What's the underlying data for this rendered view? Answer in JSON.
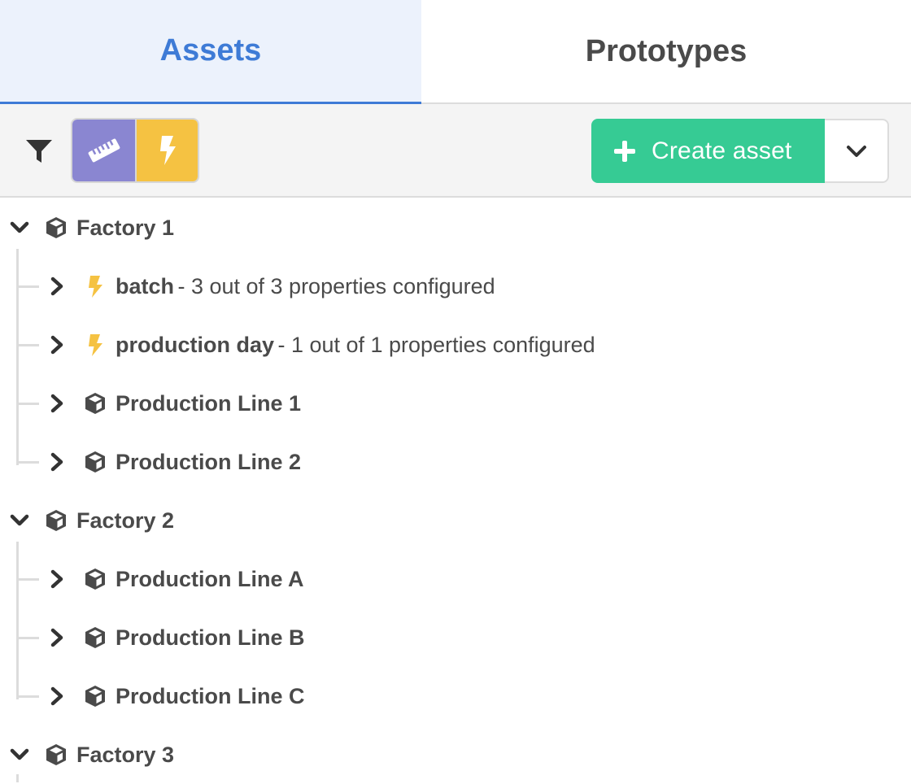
{
  "tabs": [
    {
      "label": "Assets",
      "active": true
    },
    {
      "label": "Prototypes",
      "active": false
    }
  ],
  "toolbar": {
    "filter_icon": "filter-icon",
    "toggles": [
      {
        "icon": "ruler-icon",
        "color": "#8a86d1"
      },
      {
        "icon": "bolt-icon",
        "color": "#f5c242"
      }
    ],
    "create_label": "Create asset",
    "create_color": "#36cb94",
    "dropdown_icon": "chevron-down-icon"
  },
  "tree": [
    {
      "name": "Factory 1",
      "icon": "cube-icon",
      "expanded": true,
      "children": [
        {
          "name": "batch",
          "icon": "bolt-icon",
          "desc": "- 3 out of 3 properties configured"
        },
        {
          "name": "production day",
          "icon": "bolt-icon",
          "desc": "- 1 out of 1 properties configured"
        },
        {
          "name": "Production Line 1",
          "icon": "cube-icon",
          "desc": ""
        },
        {
          "name": "Production Line 2",
          "icon": "cube-icon",
          "desc": ""
        }
      ]
    },
    {
      "name": "Factory 2",
      "icon": "cube-icon",
      "expanded": true,
      "children": [
        {
          "name": "Production Line A",
          "icon": "cube-icon",
          "desc": ""
        },
        {
          "name": "Production Line B",
          "icon": "cube-icon",
          "desc": ""
        },
        {
          "name": "Production Line C",
          "icon": "cube-icon",
          "desc": ""
        }
      ]
    },
    {
      "name": "Factory 3",
      "icon": "cube-icon",
      "expanded": true,
      "children": []
    }
  ],
  "colors": {
    "accent": "#3e7bd6",
    "text": "#4a4a4a",
    "bolt": "#f5c242"
  }
}
